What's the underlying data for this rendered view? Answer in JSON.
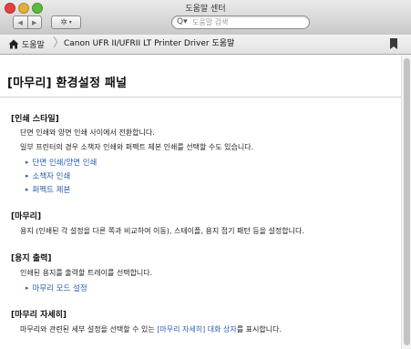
{
  "window": {
    "title": "도움말 센터",
    "back_glyph": "◀",
    "forward_glyph": "▶",
    "gear_glyph": "✲",
    "gear_caret": "▾",
    "search_placeholder": "도움말 검색",
    "search_glyph": "Q▾"
  },
  "breadcrumb": {
    "home_label": "도움말",
    "current": "Canon UFR II/UFRII LT Printer Driver 도움말"
  },
  "page": {
    "title": "[마무리] 환경설정 패널",
    "sections": [
      {
        "title": "[인쇄 스타일]",
        "lines": [
          "단면 인쇄와 양면 인쇄 사이에서 전환합니다.",
          "일부 프린터의 경우 소책자 인쇄와 퍼펙트 제본 인쇄를 선택할 수도 있습니다."
        ],
        "links": [
          "단면 인쇄/양면 인쇄",
          "소책자 인쇄",
          "퍼펙트 제본"
        ]
      },
      {
        "title": "[마무리]",
        "lines": [
          "용지 (인쇄된 각 설정을 다른 쪽과 비교하여 이동), 스테이플, 용지 접기 패턴 등을 설정합니다."
        ]
      },
      {
        "title": "[용지 출력]",
        "lines": [
          "인쇄된 용지를 출력할 트레이를 선택합니다."
        ],
        "links": [
          "마무리 모드 설정"
        ]
      },
      {
        "title": "[마무리 자세히]",
        "line_before": "마무리와 관련된 세부 설정을 선택할 수 있는 ",
        "line_link": "[마무리 자세히] 대화 상자",
        "line_after": "를 표시합니다."
      }
    ],
    "link_arrow": "▸"
  },
  "colors": {
    "link": "#2a5fb5",
    "titlebar_top": "#ebebeb",
    "titlebar_bottom": "#c8c8c8"
  }
}
